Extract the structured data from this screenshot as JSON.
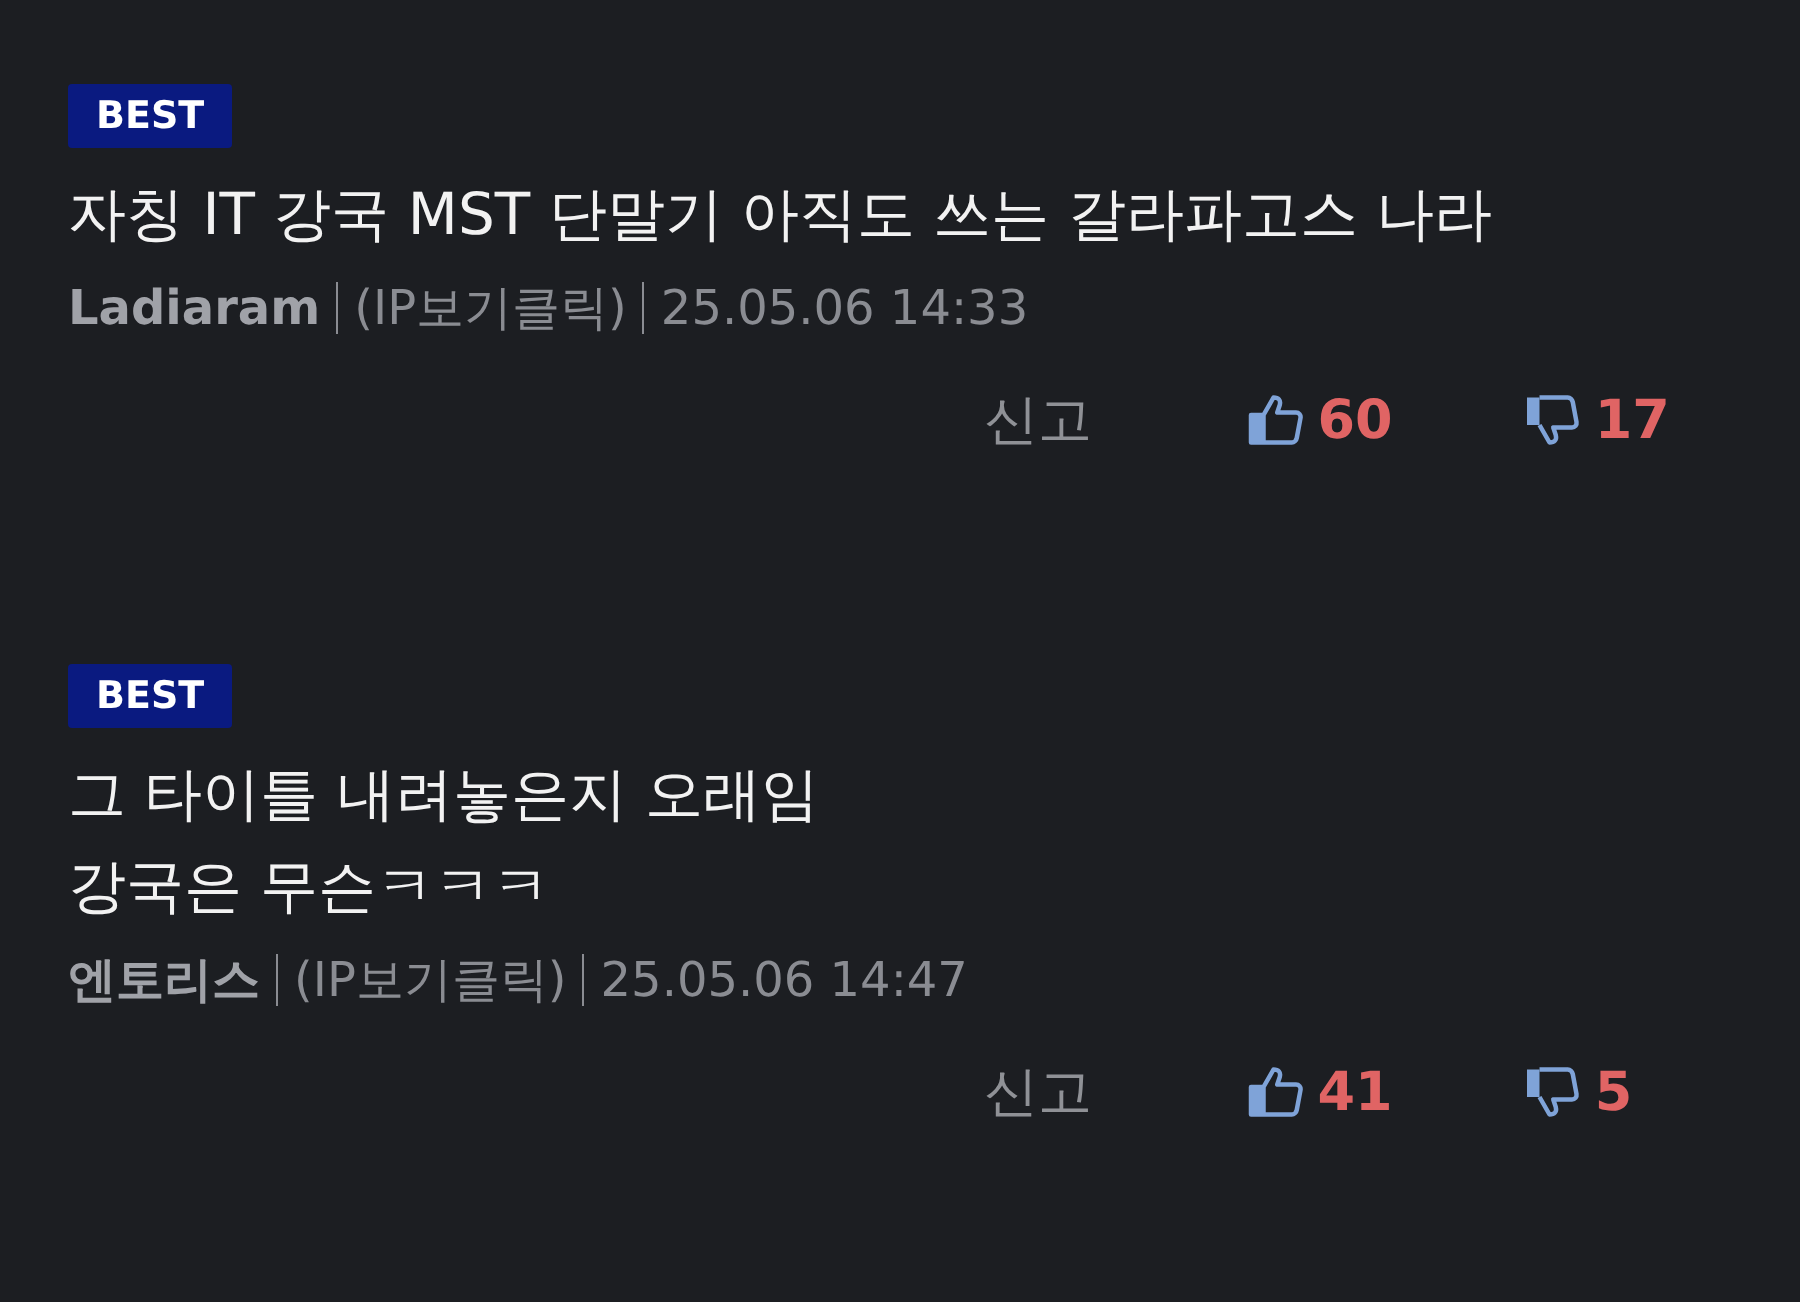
{
  "comments": [
    {
      "badge": "BEST",
      "lines": [
        "자칭 IT 강국  MST 단말기 아직도 쓰는 갈라파고스 나라"
      ],
      "author": "Ladiaram",
      "ip": "(IP보기클릭)",
      "date": "25.05.06 14:33",
      "report": "신고",
      "likes": "60",
      "dislikes": "17"
    },
    {
      "badge": "BEST",
      "lines": [
        "그 타이틀 내려놓은지 오래임",
        "강국은 무슨ㅋㅋㅋ"
      ],
      "author": "엔토리스",
      "ip": "(IP보기클릭)",
      "date": "25.05.06 14:47",
      "report": "신고",
      "likes": "41",
      "dislikes": "5"
    }
  ]
}
